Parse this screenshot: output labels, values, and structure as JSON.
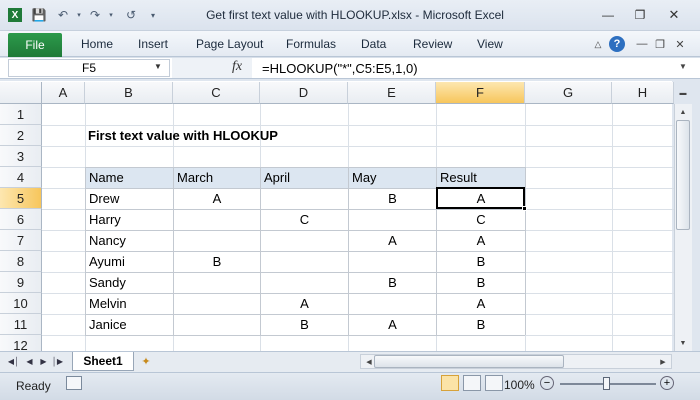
{
  "window": {
    "title": "Get first text value with HLOOKUP.xlsx  -  Microsoft Excel"
  },
  "ribbon": {
    "file_label": "File",
    "tabs": [
      "Home",
      "Insert",
      "Page Layout",
      "Formulas",
      "Data",
      "Review",
      "View"
    ]
  },
  "formula_bar": {
    "name_box": "F5",
    "fx_label": "fx",
    "formula": "=HLOOKUP(\"*\",C5:E5,1,0)"
  },
  "columns": [
    "A",
    "B",
    "C",
    "D",
    "E",
    "F",
    "G",
    "H"
  ],
  "selected_column": "F",
  "rows": [
    "1",
    "2",
    "3",
    "4",
    "5",
    "6",
    "7",
    "8",
    "9",
    "10",
    "11",
    "12"
  ],
  "selected_row": "5",
  "sheet": {
    "title": "First text value with HLOOKUP",
    "table": {
      "headers": [
        "Name",
        "March",
        "April",
        "May",
        "Result"
      ],
      "rows": [
        [
          "Drew",
          "A",
          "",
          "B",
          "A"
        ],
        [
          "Harry",
          "",
          "C",
          "",
          "C"
        ],
        [
          "Nancy",
          "",
          "",
          "A",
          "A"
        ],
        [
          "Ayumi",
          "B",
          "",
          "",
          "B"
        ],
        [
          "Sandy",
          "",
          "",
          "B",
          "B"
        ],
        [
          "Melvin",
          "",
          "A",
          "",
          "A"
        ],
        [
          "Janice",
          "",
          "B",
          "A",
          "B"
        ]
      ]
    },
    "active_cell": "F5"
  },
  "sheet_tabs": {
    "active": "Sheet1"
  },
  "status": {
    "ready": "Ready",
    "zoom": "100%",
    "zoom_minus": "−",
    "zoom_plus": "+"
  },
  "colors": {
    "file_tab": "#1f7a38",
    "table_header_fill": "#dce6f1",
    "selected_header": "#f7c65c"
  }
}
